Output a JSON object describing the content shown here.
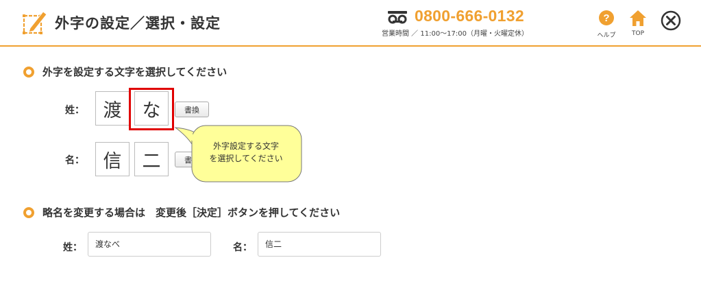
{
  "header": {
    "title": "外字の設定／選択・設定",
    "phone_number": "0800-666-0132",
    "business_hours": "営業時間 ／ 11:00～17:00（月曜・火曜定休）",
    "help_label": "ヘルプ",
    "top_label": "TOP",
    "accent_color": "#f0a030"
  },
  "section1": {
    "heading": "外字を設定する文字を選択してください",
    "surname_label": "姓：",
    "surname_chars": [
      "渡",
      "な"
    ],
    "given_label": "名：",
    "given_chars": [
      "信",
      "二"
    ],
    "replace_button_label": "書換",
    "tooltip_lines": [
      "外字設定する文字",
      "を選択してください"
    ]
  },
  "section2": {
    "heading": "略名を変更する場合は　変更後［決定］ボタンを押してください",
    "surname_label": "姓：",
    "surname_value": "渡なべ",
    "given_label": "名：",
    "given_value": "信二"
  }
}
